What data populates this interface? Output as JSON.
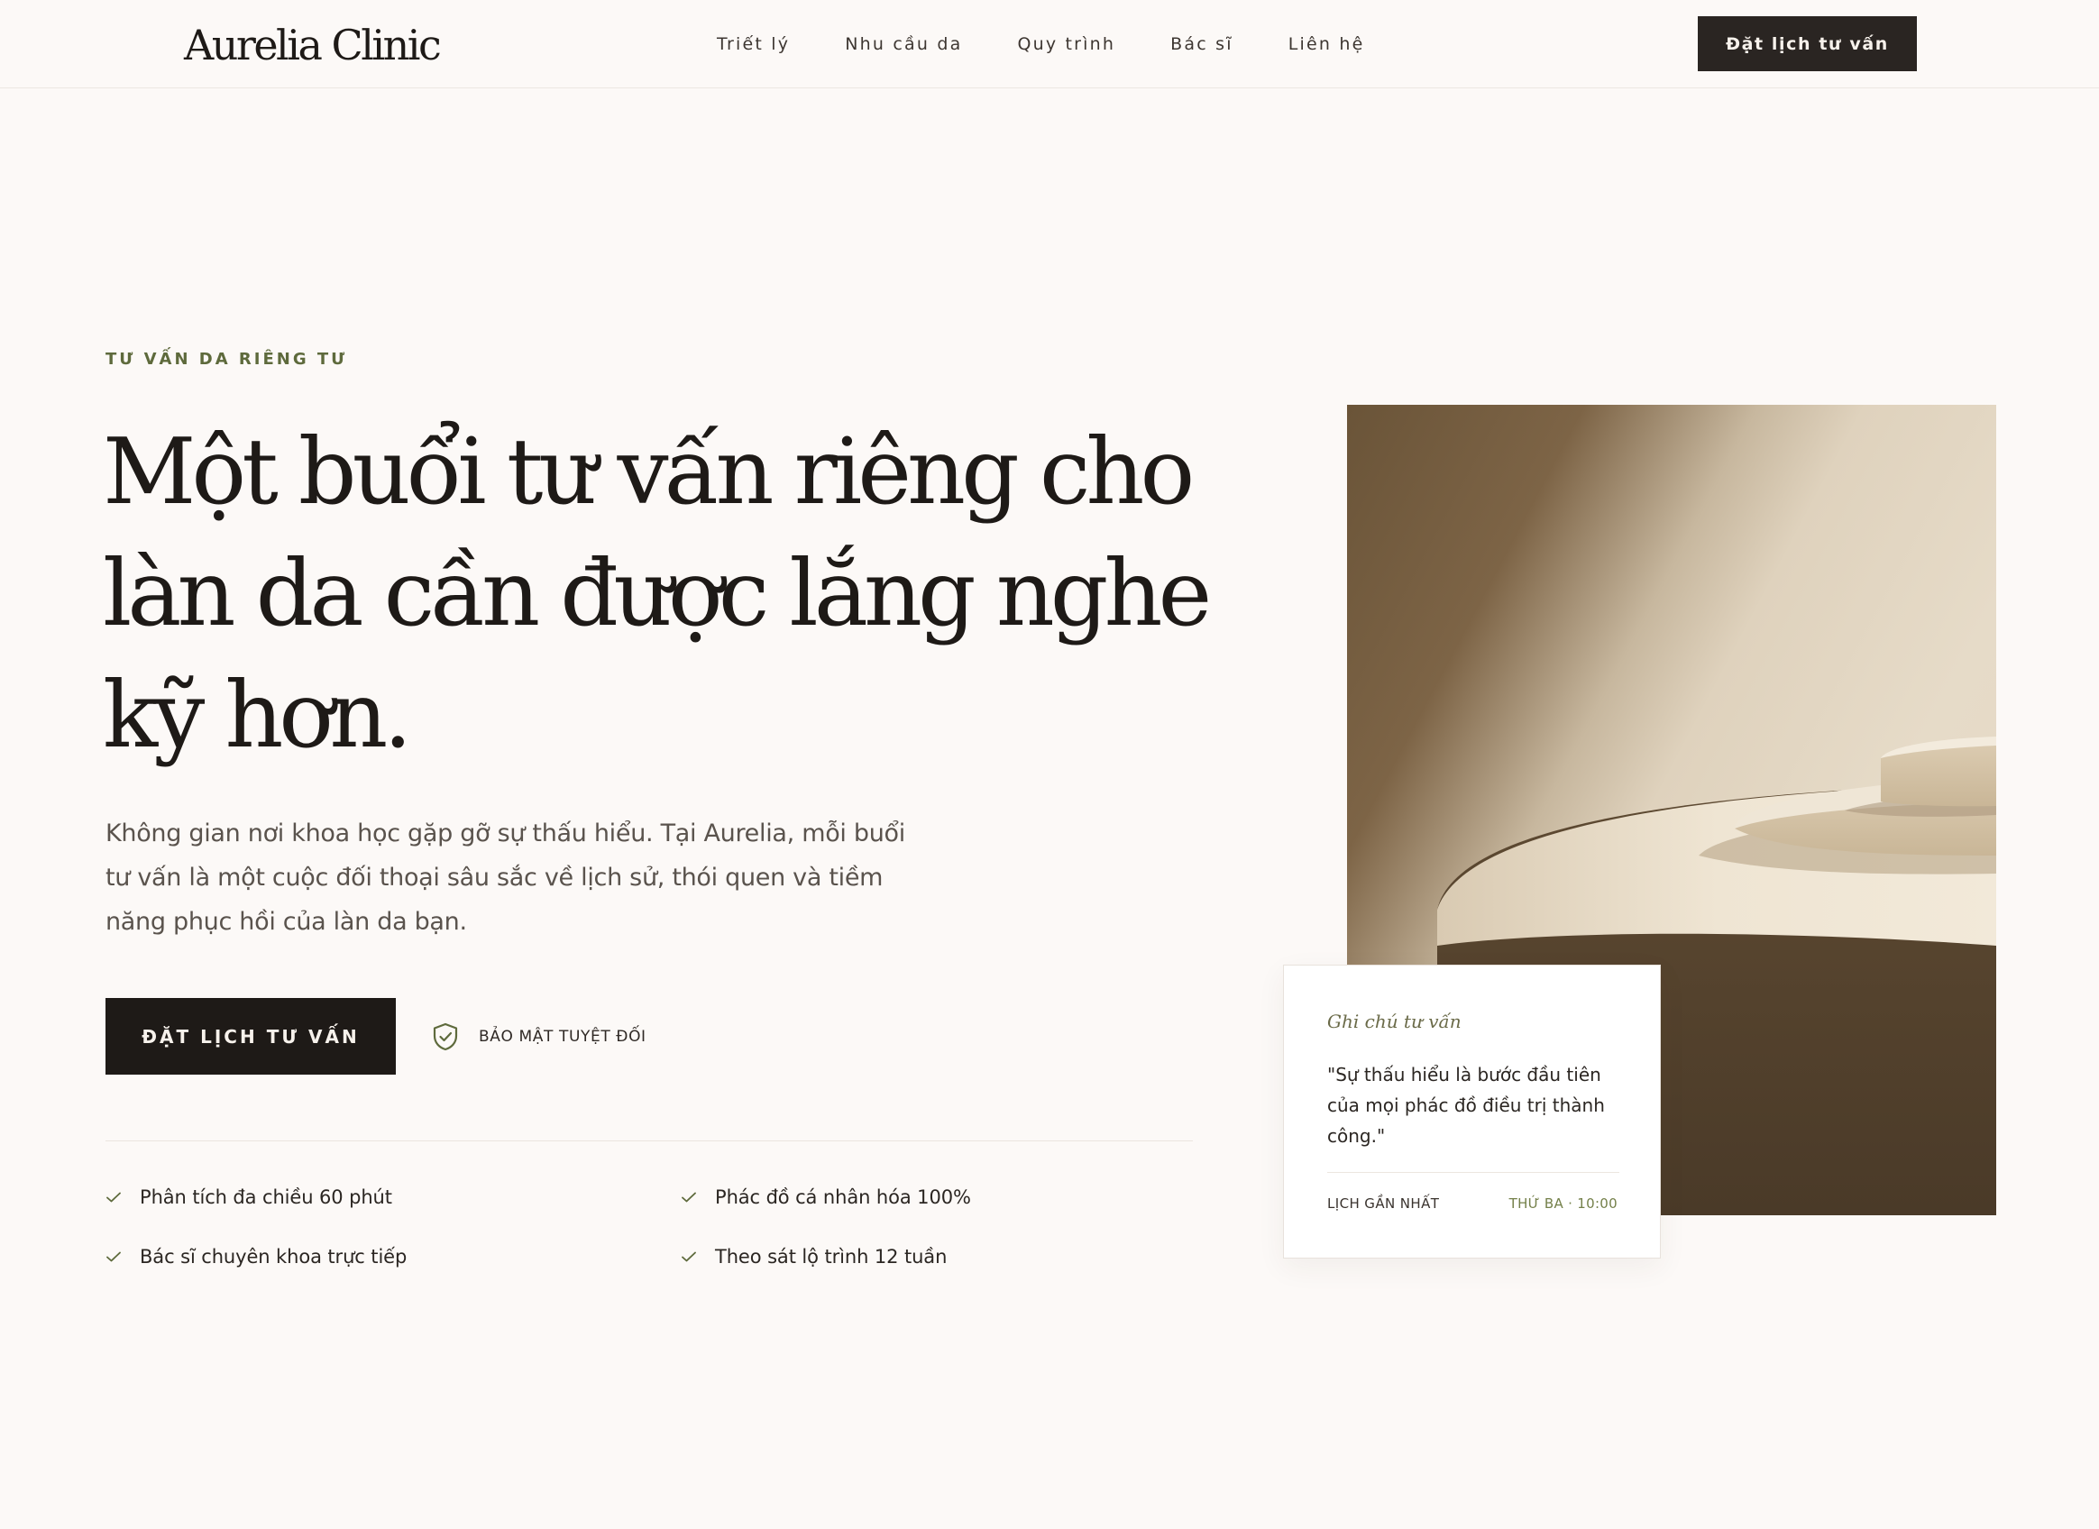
{
  "header": {
    "logo": "Aurelia Clinic",
    "nav": [
      "Triết lý",
      "Nhu cầu da",
      "Quy trình",
      "Bác sĩ",
      "Liên hệ"
    ],
    "cta_label": "Đặt lịch tư vấn"
  },
  "hero": {
    "eyebrow": "TƯ VẤN DA RIÊNG TƯ",
    "headline_lines": [
      "Một buổi tư vấn riêng cho",
      "làn da cần được lắng nghe",
      "kỹ hơn."
    ],
    "lede": "Không gian nơi khoa học gặp gỡ sự thấu hiểu. Tại Aurelia, mỗi buổi tư vấn là một cuộc đối thoại sâu sắc về lịch sử, thói quen và tiềm năng phục hồi của làn da bạn.",
    "cta_label": "ĐẶT LỊCH TƯ VẤN",
    "security_label": "BẢO MẬT TUYỆT ĐỐI",
    "security_icon": "shield-check-icon",
    "features": [
      "Phân tích đa chiều 60 phút",
      "Phác đồ cá nhân hóa 100%",
      "Bác sĩ chuyên khoa trực tiếp",
      "Theo sát lộ trình 12 tuần"
    ],
    "feature_icon": "check-icon"
  },
  "note_card": {
    "title": "Ghi chú tư vấn",
    "quote": "\"Sự thấu hiểu là bước đầu tiên của mọi phác đồ điều trị thành công.\"",
    "schedule_label": "LỊCH GẦN NHẤT",
    "schedule_time": "THỨ BA · 10:00"
  },
  "colors": {
    "background": "#fcf9f7",
    "ink": "#1e1a17",
    "accent_olive": "#5e6a3c",
    "button_dark": "#1e1a17"
  }
}
